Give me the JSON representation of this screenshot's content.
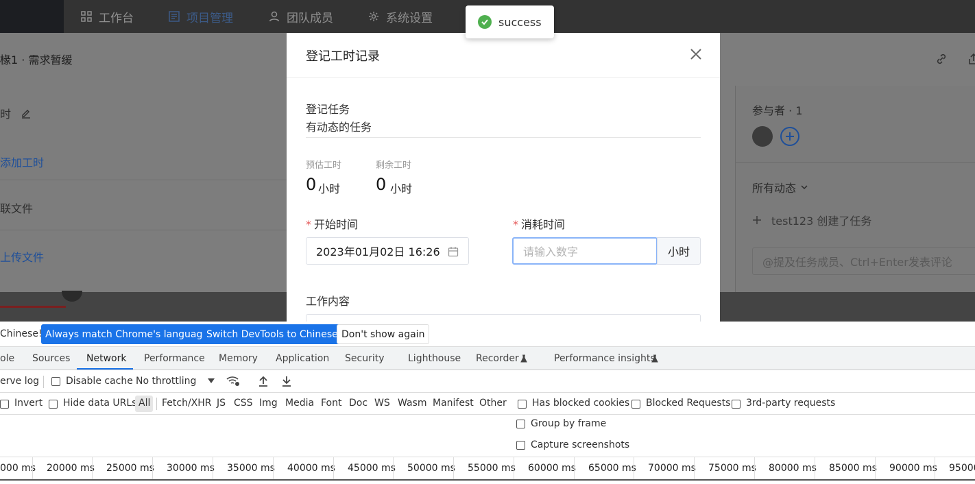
{
  "app": {
    "nav": [
      {
        "label": "工作台",
        "icon": "grid-icon"
      },
      {
        "label": "项目管理",
        "icon": "project-icon"
      },
      {
        "label": "团队成员",
        "icon": "user-icon"
      },
      {
        "label": "系统设置",
        "icon": "gear-icon"
      }
    ],
    "breadcrumb": "椽1 · 需求暂缓",
    "left": {
      "hours_label": "时",
      "add_hours": "添加工时",
      "related_files": "联文件",
      "upload": "上传文件"
    },
    "right": {
      "participants": "参与者 · 1",
      "all_activity": "所有动态",
      "activity_item": "test123 创建了任务",
      "comment_placeholder": "@提及任务成员、Ctrl+Enter发表评论"
    }
  },
  "toast": {
    "message": "success"
  },
  "modal": {
    "title": "登记工时记录",
    "task_label": "登记任务",
    "task_name": "有动态的任务",
    "estimated_label": "预估工时",
    "estimated_value": "0",
    "remaining_label": "剩余工时",
    "remaining_value": "0",
    "hour_unit": "小时",
    "start_time_label": "开始时间",
    "start_time_value": "2023年01月02日 16:26",
    "consumed_label": "消耗时间",
    "consumed_placeholder": "请输入数字",
    "consumed_suffix": "小时",
    "content_label": "工作内容",
    "required_mark": "*"
  },
  "devtools": {
    "infobar": {
      "text": "Chinese!",
      "btn_match": "Always match Chrome's language",
      "btn_switch": "Switch DevTools to Chinese",
      "btn_dismiss": "Don't show again"
    },
    "tabs": [
      "ole",
      "Sources",
      "Network",
      "Performance",
      "Memory",
      "Application",
      "Security",
      "Lighthouse",
      "Recorder",
      "Performance insights"
    ],
    "active_tab": "Network",
    "toolbar": {
      "preserve_log": "erve log",
      "disable_cache": "Disable cache",
      "throttling": "No throttling"
    },
    "filters": {
      "invert": "Invert",
      "hide_data_urls": "Hide data URLs",
      "types": [
        "All",
        "Fetch/XHR",
        "JS",
        "CSS",
        "Img",
        "Media",
        "Font",
        "Doc",
        "WS",
        "Wasm",
        "Manifest",
        "Other"
      ],
      "has_blocked_cookies": "Has blocked cookies",
      "blocked_requests": "Blocked Requests",
      "third_party": "3rd-party requests",
      "group_by_frame": "Group by frame",
      "capture_screenshots": "Capture screenshots"
    },
    "timeline_ticks": [
      "000 ms",
      "20000 ms",
      "25000 ms",
      "30000 ms",
      "35000 ms",
      "40000 ms",
      "45000 ms",
      "50000 ms",
      "55000 ms",
      "60000 ms",
      "65000 ms",
      "70000 ms",
      "75000 ms",
      "80000 ms",
      "85000 ms",
      "90000 ms",
      "95000"
    ]
  }
}
